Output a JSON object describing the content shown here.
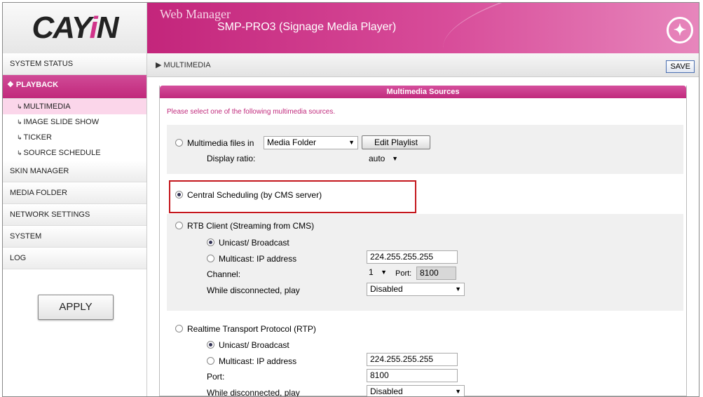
{
  "header": {
    "logo_text": "CAYIN",
    "web_manager": "Web Manager",
    "product": "SMP-PRO3 (Signage Media Player)"
  },
  "sidebar": {
    "items": [
      {
        "label": "SYSTEM STATUS"
      },
      {
        "label": "PLAYBACK"
      },
      {
        "label": "SKIN MANAGER"
      },
      {
        "label": "MEDIA FOLDER"
      },
      {
        "label": "NETWORK SETTINGS"
      },
      {
        "label": "SYSTEM"
      },
      {
        "label": "LOG"
      }
    ],
    "playback_sub": [
      "MULTIMEDIA",
      "IMAGE SLIDE SHOW",
      "TICKER",
      "SOURCE SCHEDULE"
    ],
    "apply_label": "APPLY"
  },
  "toolbar": {
    "breadcrumb": "MULTIMEDIA",
    "save_label": "SAVE"
  },
  "panel": {
    "title": "Multimedia Sources",
    "hint": "Please select one of the following multimedia sources.",
    "files": {
      "label": "Multimedia files in",
      "folder_value": "Media Folder",
      "edit_playlist": "Edit Playlist",
      "ratio_label": "Display ratio:",
      "ratio_value": "auto"
    },
    "central": {
      "label": "Central Scheduling (by CMS server)"
    },
    "rtb": {
      "label": "RTB Client (Streaming from CMS)",
      "unicast": "Unicast/ Broadcast",
      "multicast": "Multicast: IP address",
      "ip_value": "224.255.255.255",
      "channel_label": "Channel:",
      "channel_value": "1",
      "port_label": "Port:",
      "port_value": "8100",
      "disc_label": "While disconnected, play",
      "disc_value": "Disabled"
    },
    "rtp": {
      "label": "Realtime Transport Protocol (RTP)",
      "unicast": "Unicast/ Broadcast",
      "multicast": "Multicast: IP address",
      "ip_value": "224.255.255.255",
      "port_label": "Port:",
      "port_value": "8100",
      "disc_label": "While disconnected, play",
      "disc_value": "Disabled"
    }
  }
}
